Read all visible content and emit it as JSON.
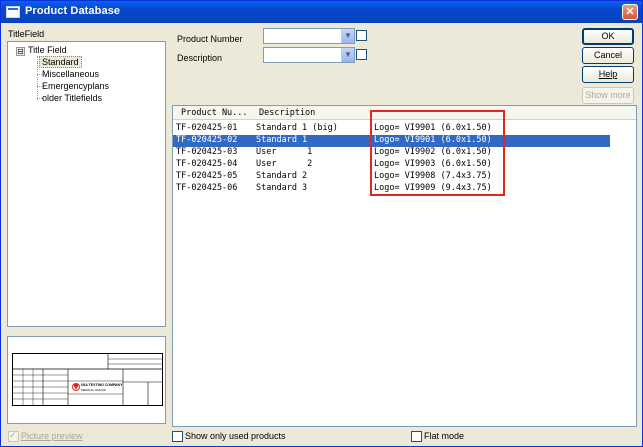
{
  "window": {
    "title": "Product Database",
    "close_label": "✕"
  },
  "sidebar": {
    "header": "TitleField",
    "tree": {
      "root_label": "Title Field",
      "expander": "⊟",
      "children": [
        {
          "label": "Standard",
          "selected": true
        },
        {
          "label": "Miscellaneous",
          "selected": false
        },
        {
          "label": "Emergencyplans",
          "selected": false
        },
        {
          "label": "older Titlefields",
          "selected": false
        }
      ]
    },
    "picture_preview_label": "Picture preview",
    "picture_preview_checked": true,
    "preview_logo_text": "IXIA TEXTING COMPANY",
    "preview_logo_subtext": "MEDICAL GROUP"
  },
  "filters": {
    "product_number_label": "Product Number",
    "description_label": "Description",
    "product_number_value": "",
    "description_value": ""
  },
  "buttons": {
    "ok": "OK",
    "cancel": "Cancel",
    "help": "Help",
    "show_more": "Show more"
  },
  "list": {
    "columns": [
      "Product Nu...",
      "Description"
    ],
    "rows": [
      {
        "number": "TF-020425-01",
        "description": "Standard 1 (big)",
        "logo": "Logo= VI9901 (6.0x1.50)",
        "selected": false
      },
      {
        "number": "TF-020425-02",
        "description": "Standard 1",
        "logo": "Logo= VI9901 (6.0x1.50)",
        "selected": true
      },
      {
        "number": "TF-020425-03",
        "description": "User      1",
        "logo": "Logo= VI9902 (6.0x1.50)",
        "selected": false
      },
      {
        "number": "TF-020425-04",
        "description": "User      2",
        "logo": "Logo= VI9903 (6.0x1.50)",
        "selected": false
      },
      {
        "number": "TF-020425-05",
        "description": "Standard 2",
        "logo": "Logo= VI9908 (7.4x3.75)",
        "selected": false
      },
      {
        "number": "TF-020425-06",
        "description": "Standard 3",
        "logo": "Logo= VI9909 (9.4x3.75)",
        "selected": false
      }
    ]
  },
  "footer": {
    "show_only_used_label": "Show only used products",
    "flat_mode_label": "Flat mode"
  },
  "colors": {
    "selection": "#316ac5",
    "annotation_box": "#e0281e",
    "titlebar": "#0847c9"
  }
}
